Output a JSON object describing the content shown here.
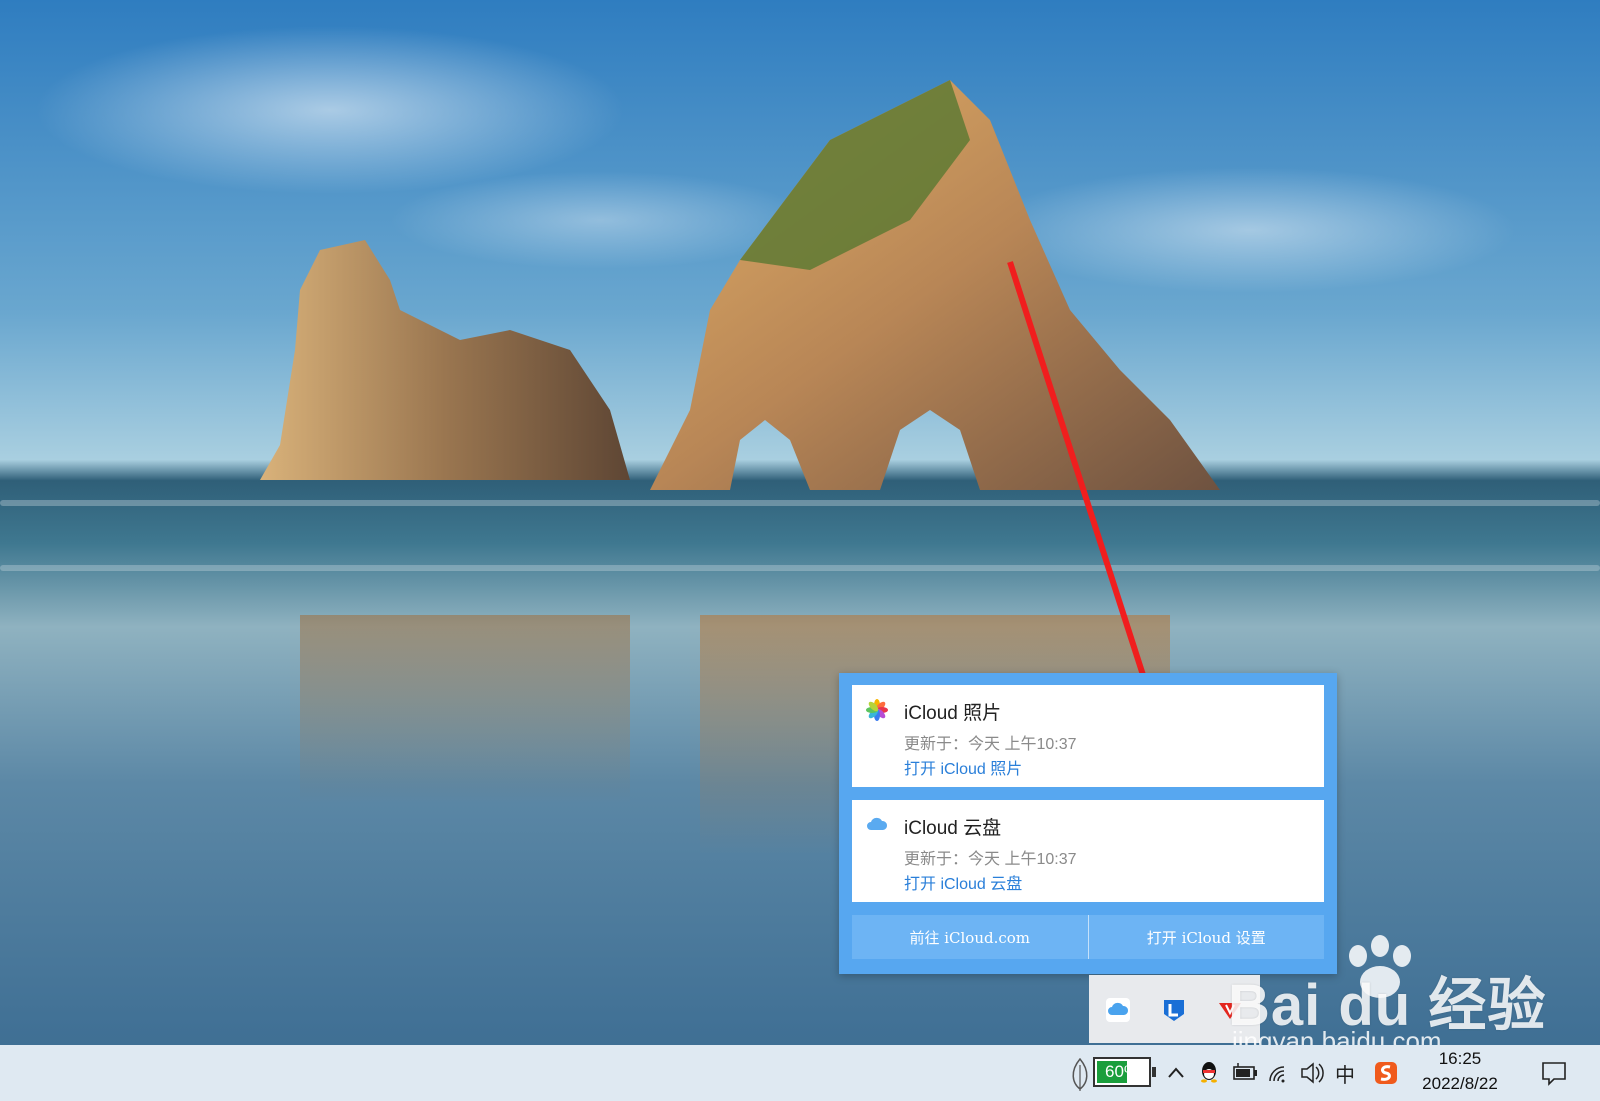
{
  "popup": {
    "cards": [
      {
        "icon": "photos-icon",
        "title": "iCloud 照片",
        "updated": "更新于：今天 上午10:37",
        "link": "打开 iCloud 照片"
      },
      {
        "icon": "icloud-drive-icon",
        "title": "iCloud 云盘",
        "updated": "更新于：今天 上午10:37",
        "link": "打开 iCloud 云盘"
      }
    ],
    "buttons": {
      "go_icloud": "前往 iCloud.com",
      "open_settings": "打开 iCloud 设置"
    },
    "accent_color": "#57a7f0"
  },
  "tray_overflow": {
    "icons": [
      "icloud-icon",
      "lenovo-icon",
      "red-app-icon"
    ]
  },
  "taskbar": {
    "battery_percent": "60%",
    "battery_level": 0.6,
    "ime_indicator": "中",
    "clock": {
      "time": "16:25",
      "date": "2022/8/22"
    },
    "tray_icons": [
      "leaf-icon",
      "battery-icon",
      "chevron-up-icon",
      "qq-icon",
      "battery-plug-icon",
      "wifi-icon",
      "volume-icon",
      "ime-icon",
      "sogou-icon",
      "notification-icon"
    ]
  },
  "watermark": {
    "brand": "Bai du 经验",
    "url": "jingyan.baidu.com"
  }
}
